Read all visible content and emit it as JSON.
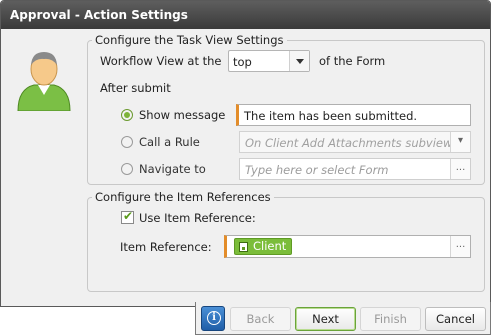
{
  "window": {
    "title": "Approval - Action Settings"
  },
  "icons": {
    "avatar": "user-avatar-icon",
    "info": "info-icon",
    "dropdown": "chevron-down-icon",
    "ellipsis": "ellipsis-icon",
    "token": "control-icon"
  },
  "task_view": {
    "legend": "Configure the Task View Settings",
    "workflow_view_label": "Workflow View at the",
    "workflow_view_value": "top",
    "form_suffix": "of the Form",
    "after_submit_label": "After submit",
    "options": {
      "show_message": {
        "label": "Show message",
        "selected": true,
        "value": "The item has been submitted."
      },
      "call_rule": {
        "label": "Call a Rule",
        "selected": false,
        "value": "On Client Add Attachments subview,"
      },
      "navigate_to": {
        "label": "Navigate to",
        "selected": false,
        "placeholder": "Type here or select Form",
        "button": "..."
      }
    }
  },
  "item_refs": {
    "legend": "Configure the Item References",
    "use_item_reference_label": "Use Item Reference:",
    "use_item_reference_checked": true,
    "item_reference_label": "Item Reference:",
    "item_reference_token": "Client",
    "button": "..."
  },
  "footer": {
    "info_glyph": "i",
    "back": "Back",
    "next": "Next",
    "finish": "Finish",
    "cancel": "Cancel"
  },
  "colors": {
    "accent_green": "#7bbd3a",
    "required_orange": "#e38d2a",
    "titlebar": "#3a3a3a"
  }
}
